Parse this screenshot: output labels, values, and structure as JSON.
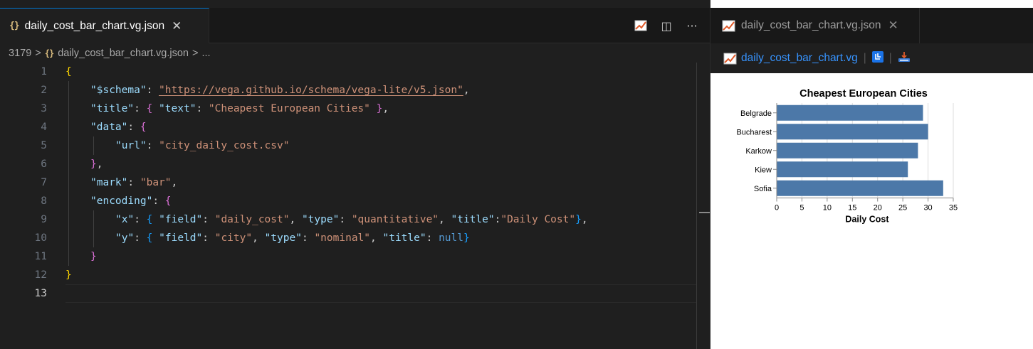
{
  "editor": {
    "tab": {
      "filename": "daily_cost_bar_chart.vg.json",
      "close": "✕",
      "icon": "json-braces-icon"
    },
    "actions": [
      "chart-preview-icon",
      "split-editor-icon",
      "more-actions-icon"
    ],
    "actions_glyph": {
      "split": "◫",
      "more": "···"
    },
    "breadcrumb": {
      "folder": "3179",
      "file": "daily_cost_bar_chart.vg.json",
      "tail": "...",
      "separator": ">"
    },
    "current_line": 13,
    "lines": [
      {
        "n": "1",
        "indent": 0,
        "tokens": [
          [
            "b1",
            "{"
          ]
        ]
      },
      {
        "n": "2",
        "indent": 1,
        "tokens": [
          [
            "k",
            "\"$schema\""
          ],
          [
            "p",
            ": "
          ],
          [
            "u",
            "\"https://vega.github.io/schema/vega-lite/v5.json\""
          ],
          [
            "p",
            ","
          ]
        ]
      },
      {
        "n": "3",
        "indent": 1,
        "tokens": [
          [
            "k",
            "\"title\""
          ],
          [
            "p",
            ": "
          ],
          [
            "b2",
            "{"
          ],
          [
            "p",
            " "
          ],
          [
            "k",
            "\"text\""
          ],
          [
            "p",
            ": "
          ],
          [
            "s",
            "\"Cheapest European Cities\""
          ],
          [
            "p",
            " "
          ],
          [
            "b2",
            "}"
          ],
          [
            "p",
            ","
          ]
        ]
      },
      {
        "n": "4",
        "indent": 1,
        "tokens": [
          [
            "k",
            "\"data\""
          ],
          [
            "p",
            ": "
          ],
          [
            "b2",
            "{"
          ]
        ]
      },
      {
        "n": "5",
        "indent": 2,
        "tokens": [
          [
            "k",
            "\"url\""
          ],
          [
            "p",
            ": "
          ],
          [
            "s",
            "\"city_daily_cost.csv\""
          ]
        ]
      },
      {
        "n": "6",
        "indent": 1,
        "tokens": [
          [
            "b2",
            "}"
          ],
          [
            "p",
            ","
          ]
        ]
      },
      {
        "n": "7",
        "indent": 1,
        "tokens": [
          [
            "k",
            "\"mark\""
          ],
          [
            "p",
            ": "
          ],
          [
            "s",
            "\"bar\""
          ],
          [
            "p",
            ","
          ]
        ]
      },
      {
        "n": "8",
        "indent": 1,
        "tokens": [
          [
            "k",
            "\"encoding\""
          ],
          [
            "p",
            ": "
          ],
          [
            "b2",
            "{"
          ]
        ]
      },
      {
        "n": "9",
        "indent": 2,
        "tokens": [
          [
            "k",
            "\"x\""
          ],
          [
            "p",
            ": "
          ],
          [
            "b3",
            "{"
          ],
          [
            "p",
            " "
          ],
          [
            "k",
            "\"field\""
          ],
          [
            "p",
            ": "
          ],
          [
            "s",
            "\"daily_cost\""
          ],
          [
            "p",
            ", "
          ],
          [
            "k",
            "\"type\""
          ],
          [
            "p",
            ": "
          ],
          [
            "s",
            "\"quantitative\""
          ],
          [
            "p",
            ", "
          ],
          [
            "k",
            "\"title\""
          ],
          [
            "p",
            ":"
          ],
          [
            "s",
            "\"Daily Cost\""
          ],
          [
            "b3",
            "}"
          ],
          [
            "p",
            ","
          ]
        ]
      },
      {
        "n": "10",
        "indent": 2,
        "tokens": [
          [
            "k",
            "\"y\""
          ],
          [
            "p",
            ": "
          ],
          [
            "b3",
            "{"
          ],
          [
            "p",
            " "
          ],
          [
            "k",
            "\"field\""
          ],
          [
            "p",
            ": "
          ],
          [
            "s",
            "\"city\""
          ],
          [
            "p",
            ", "
          ],
          [
            "k",
            "\"type\""
          ],
          [
            "p",
            ": "
          ],
          [
            "s",
            "\"nominal\""
          ],
          [
            "p",
            ", "
          ],
          [
            "k",
            "\"title\""
          ],
          [
            "p",
            ": "
          ],
          [
            "n",
            "null"
          ],
          [
            "b3",
            "}"
          ]
        ]
      },
      {
        "n": "11",
        "indent": 1,
        "tokens": [
          [
            "b2",
            "}"
          ]
        ]
      },
      {
        "n": "12",
        "indent": 0,
        "tokens": [
          [
            "b1",
            "}"
          ]
        ]
      },
      {
        "n": "13",
        "indent": 0,
        "tokens": []
      }
    ]
  },
  "preview": {
    "tab": {
      "filename": "daily_cost_bar_chart.vg.json",
      "close": "✕",
      "icon": "chart-icon"
    },
    "toolbar": {
      "link": "daily_cost_bar_chart.vg",
      "icons": [
        "chart-icon",
        "data-table-icon",
        "export-icon"
      ]
    }
  },
  "colors": {
    "bar": "#4c78a8",
    "accent": "#0078d4",
    "link": "#3794ff"
  },
  "chart_data": {
    "type": "bar",
    "orientation": "horizontal",
    "title": "Cheapest European Cities",
    "xlabel": "Daily Cost",
    "ylabel": "",
    "categories": [
      "Belgrade",
      "Bucharest",
      "Karkow",
      "Kiew",
      "Sofia"
    ],
    "values": [
      29,
      30,
      28,
      26,
      33
    ],
    "xlim": [
      0,
      35
    ],
    "xticks": [
      "0",
      "5",
      "10",
      "15",
      "20",
      "25",
      "30",
      "35"
    ],
    "grid": true,
    "legend": "none"
  }
}
